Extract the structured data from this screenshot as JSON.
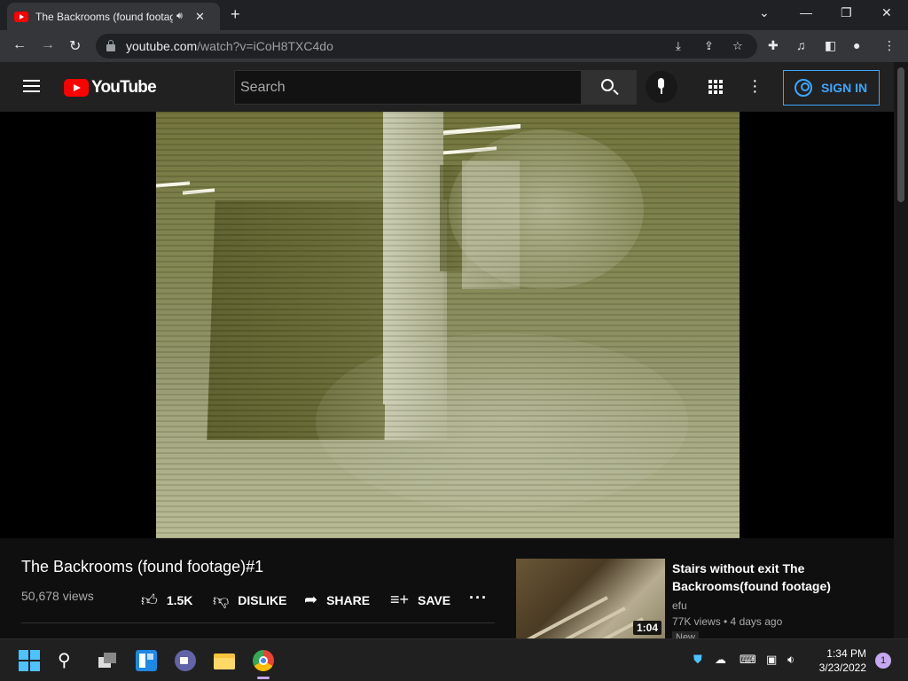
{
  "browser": {
    "tab": {
      "title": "The Backrooms (found footage)#1",
      "audio_icon": "speaker-icon",
      "close": "✕"
    },
    "newtab": "+",
    "window_controls": {
      "minimize": "⌄",
      "minimize2": "—",
      "restore": "❐",
      "close": "✕"
    },
    "address": {
      "host": "youtube.com",
      "path": "/watch?v=iCoH8TXC4do"
    }
  },
  "youtube": {
    "logo_text": "YouTube",
    "search": {
      "placeholder": "Search"
    },
    "sign_in": "SIGN IN",
    "brand_color": "#ff0000",
    "accent_color": "#3ea6ff"
  },
  "video": {
    "title": "The Backrooms (found footage)#1",
    "views": "50,678 views",
    "actions": {
      "like_count": "1.5K",
      "dislike": "DISLIKE",
      "share": "SHARE",
      "save": "SAVE",
      "more": "···"
    }
  },
  "recommendation": {
    "title": "Stairs without exit The Backrooms(found footage)",
    "channel": "efu",
    "meta": "77K views • 4 days ago",
    "duration": "1:04",
    "badge": "New"
  },
  "taskbar": {
    "time": "1:34 PM",
    "date": "3/23/2022",
    "notifications": "1"
  }
}
